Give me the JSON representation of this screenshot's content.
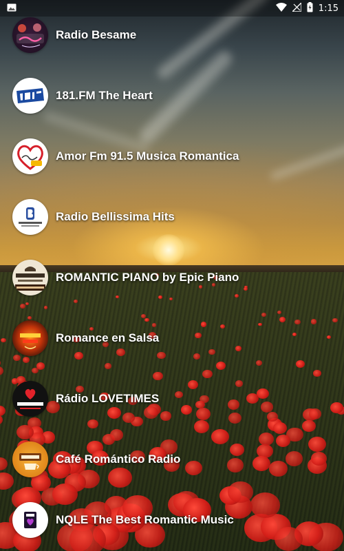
{
  "status_bar": {
    "time": "1:15",
    "icons": [
      "image-icon",
      "wifi-icon",
      "no-signal-icon",
      "battery-charging-icon"
    ]
  },
  "stations": [
    {
      "name": "Radio Besame",
      "logo_icon": "radio-besame-logo"
    },
    {
      "name": "181.FM The Heart",
      "logo_icon": "181fm-logo"
    },
    {
      "name": "Amor Fm 91.5 Musica Romantica",
      "logo_icon": "amor-fm-logo"
    },
    {
      "name": "Radio Bellissima Hits",
      "logo_icon": "radio-bellissima-logo"
    },
    {
      "name": "ROMANTIC PIANO by Epic Piano",
      "logo_icon": "epic-piano-logo"
    },
    {
      "name": "Romance en Salsa",
      "logo_icon": "romance-salsa-logo"
    },
    {
      "name": "Rádio LOVETIMES",
      "logo_icon": "lovetimes-logo"
    },
    {
      "name": "Café Romántico Radio",
      "logo_icon": "cafe-romantico-logo"
    },
    {
      "name": "NQLE The Best Romantic Music",
      "logo_icon": "nqle-logo"
    }
  ],
  "colors": {
    "text": "#ffffff",
    "status_bar_bg": "#000000",
    "poppy_red": "#d41e18"
  }
}
